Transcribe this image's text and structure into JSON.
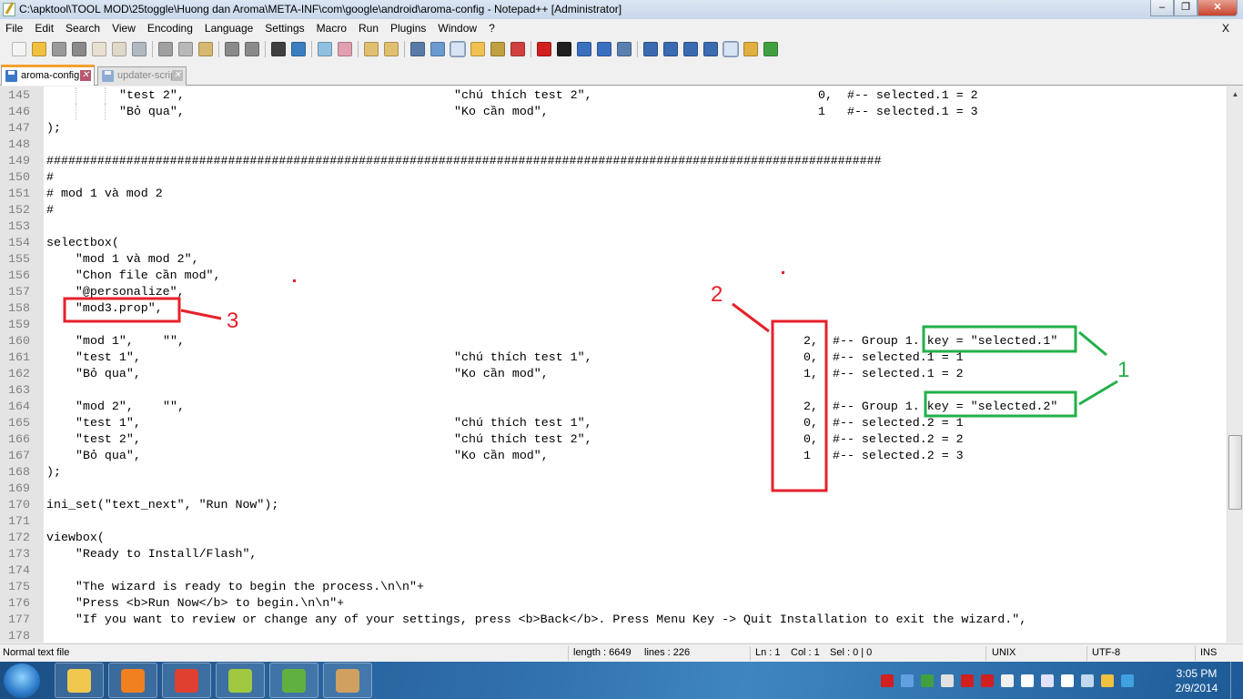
{
  "window": {
    "title": "C:\\apktool\\TOOL MOD\\25toggle\\Huong dan Aroma\\META-INF\\com\\google\\android\\aroma-config - Notepad++ [Administrator]",
    "buttons": [
      "minimize",
      "maximize",
      "close"
    ]
  },
  "menu": {
    "items": [
      "File",
      "Edit",
      "Search",
      "View",
      "Encoding",
      "Language",
      "Settings",
      "Macro",
      "Run",
      "Plugins",
      "Window",
      "?"
    ],
    "close_doc": "X"
  },
  "toolbar": {
    "icons": [
      {
        "name": "new-file-icon",
        "color": "#f4f4f4"
      },
      {
        "name": "open-file-icon",
        "color": "#f0c040"
      },
      {
        "name": "save-icon",
        "color": "#9a9a9a"
      },
      {
        "name": "save-all-icon",
        "color": "#8a8a8a"
      },
      {
        "name": "close-icon",
        "color": "#e8e0d0"
      },
      {
        "name": "close-all-icon",
        "color": "#e0d8c8"
      },
      {
        "name": "print-icon",
        "color": "#b0b8c0"
      },
      {
        "sep": true
      },
      {
        "name": "cut-icon",
        "color": "#a0a0a0"
      },
      {
        "name": "copy-icon",
        "color": "#b8b8b8"
      },
      {
        "name": "paste-icon",
        "color": "#d8b870"
      },
      {
        "sep": true
      },
      {
        "name": "undo-icon",
        "color": "#8a8a8a"
      },
      {
        "name": "redo-icon",
        "color": "#8a8a8a"
      },
      {
        "sep": true
      },
      {
        "name": "find-icon",
        "color": "#404040"
      },
      {
        "name": "replace-icon",
        "color": "#3a80c0"
      },
      {
        "sep": true
      },
      {
        "name": "zoom-in-icon",
        "color": "#90c0e0"
      },
      {
        "name": "zoom-out-icon",
        "color": "#e0a0b0"
      },
      {
        "sep": true
      },
      {
        "name": "sync-vertical-icon",
        "color": "#e0c070"
      },
      {
        "name": "sync-horizontal-icon",
        "color": "#e0c070"
      },
      {
        "sep": true
      },
      {
        "name": "word-wrap-icon",
        "color": "#5a7aa8"
      },
      {
        "name": "show-all-chars-icon",
        "color": "#6a9ad0"
      },
      {
        "name": "indent-guide-icon",
        "color": "#3a6ab0",
        "on": true
      },
      {
        "name": "udl-icon",
        "color": "#f0c050"
      },
      {
        "name": "doc-map-icon",
        "color": "#c0a040"
      },
      {
        "name": "function-list-icon",
        "color": "#d04040"
      },
      {
        "sep": true
      },
      {
        "name": "record-macro-icon",
        "color": "#d02020"
      },
      {
        "name": "stop-macro-icon",
        "color": "#202020"
      },
      {
        "name": "play-macro-icon",
        "color": "#3a70c0"
      },
      {
        "name": "play-multiple-icon",
        "color": "#3a70c0"
      },
      {
        "name": "save-macro-icon",
        "color": "#5a80b0"
      },
      {
        "sep": true
      },
      {
        "name": "collapse-icon",
        "color": "#3a6ab0"
      },
      {
        "name": "arrow-up-icon",
        "color": "#3a6ab0"
      },
      {
        "name": "arrow-down-icon",
        "color": "#3a6ab0"
      },
      {
        "name": "expand-icon",
        "color": "#3a6ab0"
      },
      {
        "name": "spellcheck-icon",
        "color": "#d04040",
        "on": true
      },
      {
        "name": "spell-options-icon",
        "color": "#e0b040"
      },
      {
        "name": "spell-auto-icon",
        "color": "#40a040"
      }
    ]
  },
  "tabs": [
    {
      "label": "aroma-config",
      "active": true
    },
    {
      "label": "updater-script",
      "active": false
    }
  ],
  "editor": {
    "lines": [
      {
        "num": "145",
        "segs": [
          "\"test 2\",",
          "\"chú thích test 2\",",
          "0,",
          "#-- selected.1 = 2"
        ]
      },
      {
        "num": "146",
        "segs": [
          "\"Bỏ qua\",",
          "\"Ko cần mod\",",
          "1",
          "#-- selected.1 = 3"
        ]
      },
      {
        "num": "147",
        "segs": [
          ");"
        ]
      },
      {
        "num": "148",
        "segs": [
          ""
        ]
      },
      {
        "num": "149",
        "segs": [
          "###################################################################################################################"
        ]
      },
      {
        "num": "150",
        "segs": [
          "#"
        ]
      },
      {
        "num": "151",
        "segs": [
          "# mod 1 và mod 2"
        ]
      },
      {
        "num": "152",
        "segs": [
          "#"
        ]
      },
      {
        "num": "153",
        "segs": [
          ""
        ]
      },
      {
        "num": "154",
        "segs": [
          "selectbox("
        ]
      },
      {
        "num": "155",
        "segs": [
          "    \"mod 1 và mod 2\","
        ]
      },
      {
        "num": "156",
        "segs": [
          "    \"Chon file cần mod\","
        ]
      },
      {
        "num": "157",
        "segs": [
          "    \"@personalize\","
        ]
      },
      {
        "num": "158",
        "segs": [
          "    \"mod3.prop\","
        ]
      },
      {
        "num": "159",
        "segs": [
          ""
        ]
      },
      {
        "num": "160",
        "segs": [
          "\"mod 1\",",
          "\"\",",
          "2,",
          "#-- Group 1. key = \"selected.1\""
        ]
      },
      {
        "num": "161",
        "segs": [
          "\"test 1\",",
          "\"chú thích test 1\",",
          "0,",
          "#-- selected.1 = 1"
        ]
      },
      {
        "num": "162",
        "segs": [
          "\"Bỏ qua\",",
          "\"Ko cần mod\",",
          "1,",
          "#-- selected.1 = 2"
        ]
      },
      {
        "num": "163",
        "segs": [
          ""
        ]
      },
      {
        "num": "164",
        "segs": [
          "\"mod 2\",",
          "\"\",",
          "2,",
          "#-- Group 1. key = \"selected.2\""
        ]
      },
      {
        "num": "165",
        "segs": [
          "\"test 1\",",
          "\"chú thích test 1\",",
          "0,",
          "#-- selected.2 = 1"
        ]
      },
      {
        "num": "166",
        "segs": [
          "\"test 2\",",
          "\"chú thích test 2\",",
          "0,",
          "#-- selected.2 = 2"
        ]
      },
      {
        "num": "167",
        "segs": [
          "\"Bỏ qua\",",
          "\"Ko cần mod\",",
          "1",
          "#-- selected.2 = 3"
        ]
      },
      {
        "num": "168",
        "segs": [
          ");"
        ]
      },
      {
        "num": "169",
        "segs": [
          ""
        ]
      },
      {
        "num": "170",
        "segs": [
          "ini_set(\"text_next\", \"Run Now\");"
        ]
      },
      {
        "num": "171",
        "segs": [
          ""
        ]
      },
      {
        "num": "172",
        "segs": [
          "viewbox("
        ]
      },
      {
        "num": "173",
        "segs": [
          "    \"Ready to Install/Flash\","
        ]
      },
      {
        "num": "174",
        "segs": [
          ""
        ]
      },
      {
        "num": "175",
        "segs": [
          "    \"The wizard is ready to begin the process.\\n\\n\"+"
        ]
      },
      {
        "num": "176",
        "segs": [
          "    \"Press <b>Run Now</b> to begin.\\n\\n\"+"
        ]
      },
      {
        "num": "177",
        "segs": [
          "    \"If you want to review or change any of your settings, press <b>Back</b>. Press Menu Key -> Quit Installation to exit the wizard.\","
        ]
      },
      {
        "num": "178",
        "segs": [
          ""
        ]
      }
    ]
  },
  "annotations": {
    "label_1": "1",
    "label_2": "2",
    "label_3": "3",
    "red": "#e8202a",
    "green": "#22b04a"
  },
  "status": {
    "file_type": "Normal text file",
    "length": "length : 6649",
    "lines": "lines : 226",
    "ln": "Ln : 1",
    "col": "Col : 1",
    "sel": "Sel : 0 | 0",
    "eol": "UNIX",
    "encoding": "UTF-8",
    "mode": "INS"
  },
  "taskbar": {
    "apps": [
      {
        "name": "explorer-icon",
        "color": "#f0c850"
      },
      {
        "name": "media-player-icon",
        "color": "#f08020"
      },
      {
        "name": "chrome-icon",
        "color": "#e04030"
      },
      {
        "name": "android-icon",
        "color": "#a0c840"
      },
      {
        "name": "notepadpp-icon",
        "color": "#60b040"
      },
      {
        "name": "paint-icon",
        "color": "#d0a060"
      }
    ],
    "tray": [
      {
        "name": "vivaldi-icon",
        "color": "#d02020"
      },
      {
        "name": "dropbox-icon",
        "color": "#60a0e0"
      },
      {
        "name": "network-share-icon",
        "color": "#40a040"
      },
      {
        "name": "flag-icon",
        "color": "#e0e0e0"
      },
      {
        "name": "bug-icon",
        "color": "#d02020"
      },
      {
        "name": "bug2-icon",
        "color": "#d02020"
      },
      {
        "name": "usb-icon",
        "color": "#f0f0f0"
      },
      {
        "name": "signal-icon",
        "color": "#ffffff"
      },
      {
        "name": "bluetooth-icon",
        "color": "#e0e0ff"
      },
      {
        "name": "volume-icon",
        "color": "#ffffff"
      },
      {
        "name": "action-center-icon",
        "color": "#c0d8f0"
      },
      {
        "name": "magic-wand-icon",
        "color": "#f0c040"
      },
      {
        "name": "teamviewer-icon",
        "color": "#40a0e0"
      }
    ],
    "time": "3:05 PM",
    "date": "2/9/2014"
  }
}
